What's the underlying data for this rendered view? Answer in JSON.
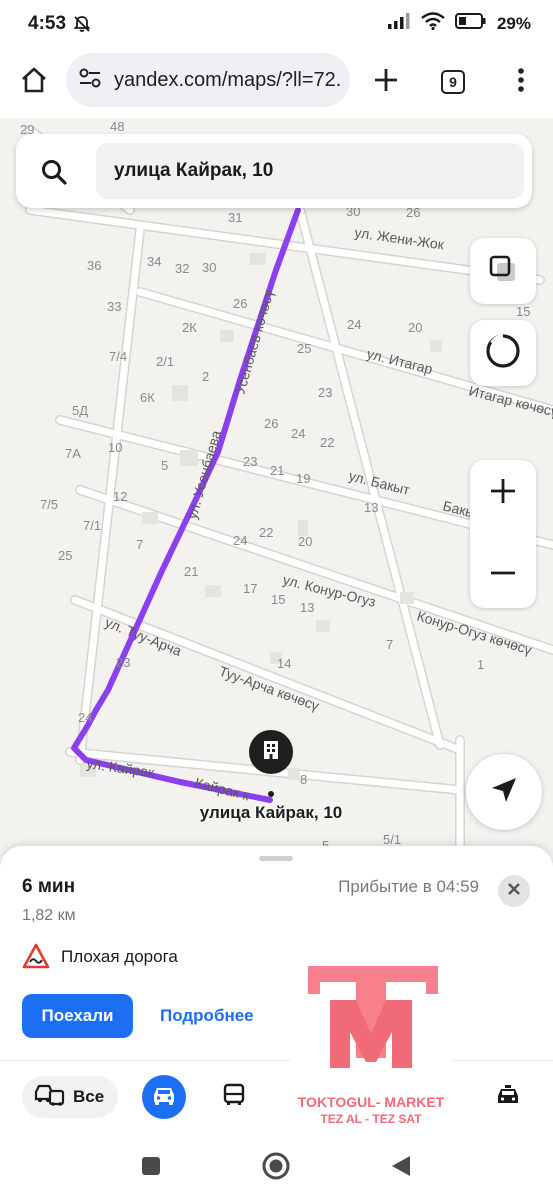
{
  "status_bar": {
    "time": "4:53",
    "battery_percent": "29%",
    "icons": [
      "notifications-muted-icon",
      "signal-icon",
      "wifi-icon",
      "battery-icon"
    ]
  },
  "browser": {
    "url": "yandex.com/maps/?ll=72.",
    "tab_count": "9",
    "icons": [
      "home-icon",
      "site-settings-icon",
      "new-tab-icon",
      "tabs-icon",
      "menu-icon"
    ]
  },
  "search": {
    "query": "улица Кайрак, 10",
    "icon": "search-icon"
  },
  "map": {
    "streets": [
      "ул. Жени-Жок",
      "ул. Итагар",
      "Итагар көчөсү",
      "ул. Бакыт",
      "Бакыт көчөсү",
      "ул. Конур-Огуз",
      "Конур-Огуз көчөсү",
      "ул. Туу-Арча",
      "Туу-Арча көчөсү",
      "ул. Кайрак",
      "Кайрак к",
      "ул. Усенбаева",
      "Усенбаев көчөсү"
    ],
    "house_numbers": [
      "29",
      "48",
      "31",
      "30",
      "26",
      "36",
      "34",
      "32",
      "30",
      "33",
      "26",
      "15",
      "2К",
      "24",
      "20",
      "25",
      "7/4",
      "2/1",
      "2",
      "23",
      "5Д",
      "6К",
      "26",
      "24",
      "22",
      "7А",
      "10",
      "5",
      "23",
      "21",
      "19",
      "7/5",
      "12",
      "13",
      "7/1",
      "7",
      "24",
      "22",
      "20",
      "25",
      "21",
      "17",
      "15",
      "13",
      "7",
      "1",
      "23",
      "14",
      "24",
      "8",
      "5/1",
      "5"
    ],
    "destination_label": "улица Кайрак, 10",
    "route_color": "#8b3ff0"
  },
  "controls": {
    "icons": [
      "layers-icon",
      "compass-icon",
      "zoom-in-icon",
      "zoom-out-icon",
      "location-arrow-icon"
    ]
  },
  "route_sheet": {
    "duration": "6 мин",
    "distance": "1,82 км",
    "arrival": "Прибытие в 04:59",
    "warning": "Плохая дорога",
    "go_button": "Поехали",
    "details_button": "Подробнее",
    "accent_color": "#1c6ef2"
  },
  "transport_modes": {
    "all_label": "Все",
    "icons": [
      "all-transport-icon",
      "car-icon",
      "bus-icon",
      "taxi-icon"
    ]
  },
  "watermark": {
    "line1": "TOKTOGUL- MARKET",
    "line2": "TEZ AL - TEZ SAT",
    "color": "#f06a77"
  },
  "nav_bar": {
    "icons": [
      "recents-icon",
      "home-circle-icon",
      "back-icon"
    ]
  }
}
